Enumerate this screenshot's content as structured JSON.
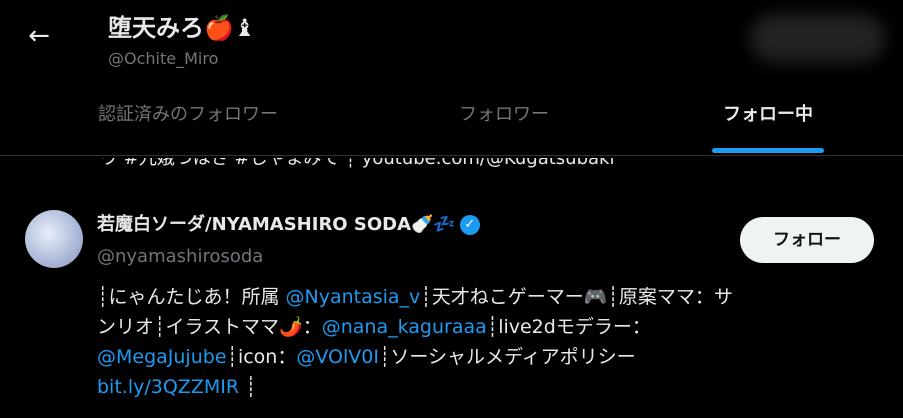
{
  "header": {
    "name": "堕天みろ🍎♝",
    "handle": "@Ochite_Miro"
  },
  "tabs": [
    {
      "label": "認証済みのフォロワー"
    },
    {
      "label": "フォロワー"
    },
    {
      "label": "フォロー中"
    }
  ],
  "prev_line": {
    "text": "ウ #九娥つはさ #しやまみて ┊ youtube.com/@Kugatsubaki"
  },
  "user": {
    "name": "若魔白ソーダ/NYAMASHIRO SODA🍼💤",
    "handle": "@nyamashirosoda",
    "follow_label": "フォロー",
    "bio": {
      "t1": "┊にゃんたじあ！所属 ",
      "l1": "@Nyantasia_v",
      "t2": "┊天才ねこゲーマー🎮┊原案ママ：サ",
      "t3": "ンリオ┊イラストママ🌶️：",
      "l2": "@nana_kaguraaa",
      "t4": "┊live2dモデラー：",
      "l3": "@MegaJujube",
      "t5": "┊icon：",
      "l4": "@VOlV0I",
      "t6": "┊ソーシャルメディアポリシー",
      "l5": "bit.ly/3QZZMIR",
      "t7": " ┊"
    }
  },
  "colors": {
    "accent": "#1d9bf0",
    "background": "#000000",
    "muted": "#71767b"
  }
}
